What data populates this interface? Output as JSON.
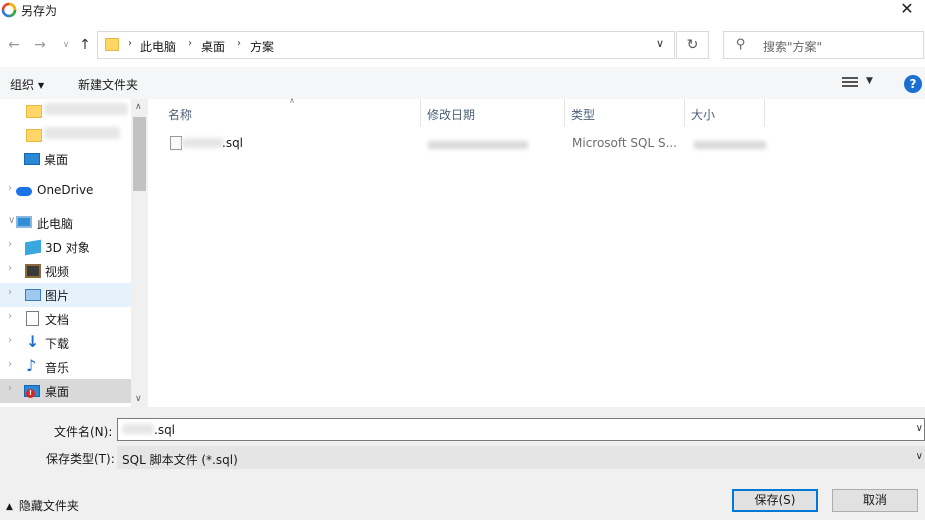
{
  "window": {
    "title": "另存为",
    "close_glyph": "✕"
  },
  "address": {
    "crumbs": [
      "此电脑",
      "桌面",
      "方案"
    ],
    "refresh_glyph": "↻",
    "search_placeholder": "搜索\"方案\""
  },
  "toolbar": {
    "organize": "组织",
    "new_folder": "新建文件夹",
    "help": "?"
  },
  "nav": {
    "items": [
      {
        "label": "",
        "icon": "folder-icon",
        "blurred": true
      },
      {
        "label": "",
        "icon": "folder-icon",
        "blurred": true
      },
      {
        "label": "桌面",
        "icon": "desktop-icon"
      },
      {
        "label": "OneDrive",
        "icon": "onedrive-cloud-icon"
      },
      {
        "label": "此电脑",
        "icon": "this-pc-icon"
      },
      {
        "label": "3D 对象",
        "icon": "3d-objects-icon"
      },
      {
        "label": "视频",
        "icon": "video-icon"
      },
      {
        "label": "图片",
        "icon": "pictures-icon"
      },
      {
        "label": "文档",
        "icon": "documents-icon"
      },
      {
        "label": "下载",
        "icon": "downloads-icon"
      },
      {
        "label": "音乐",
        "icon": "music-icon"
      },
      {
        "label": "桌面",
        "icon": "desktop-warning-icon"
      }
    ]
  },
  "file_list": {
    "columns": [
      "名称",
      "修改日期",
      "类型",
      "大小"
    ],
    "rows": [
      {
        "name": ".sql",
        "type": "Microsoft SQL S..."
      }
    ]
  },
  "save_form": {
    "filename_label": "文件名(N):",
    "filename_value": ".sql",
    "filetype_label": "保存类型(T):",
    "filetype_value": "SQL 脚本文件 (*.sql)"
  },
  "footer": {
    "hide_folders": "隐藏文件夹",
    "save": "保存(S)",
    "cancel": "取消"
  }
}
